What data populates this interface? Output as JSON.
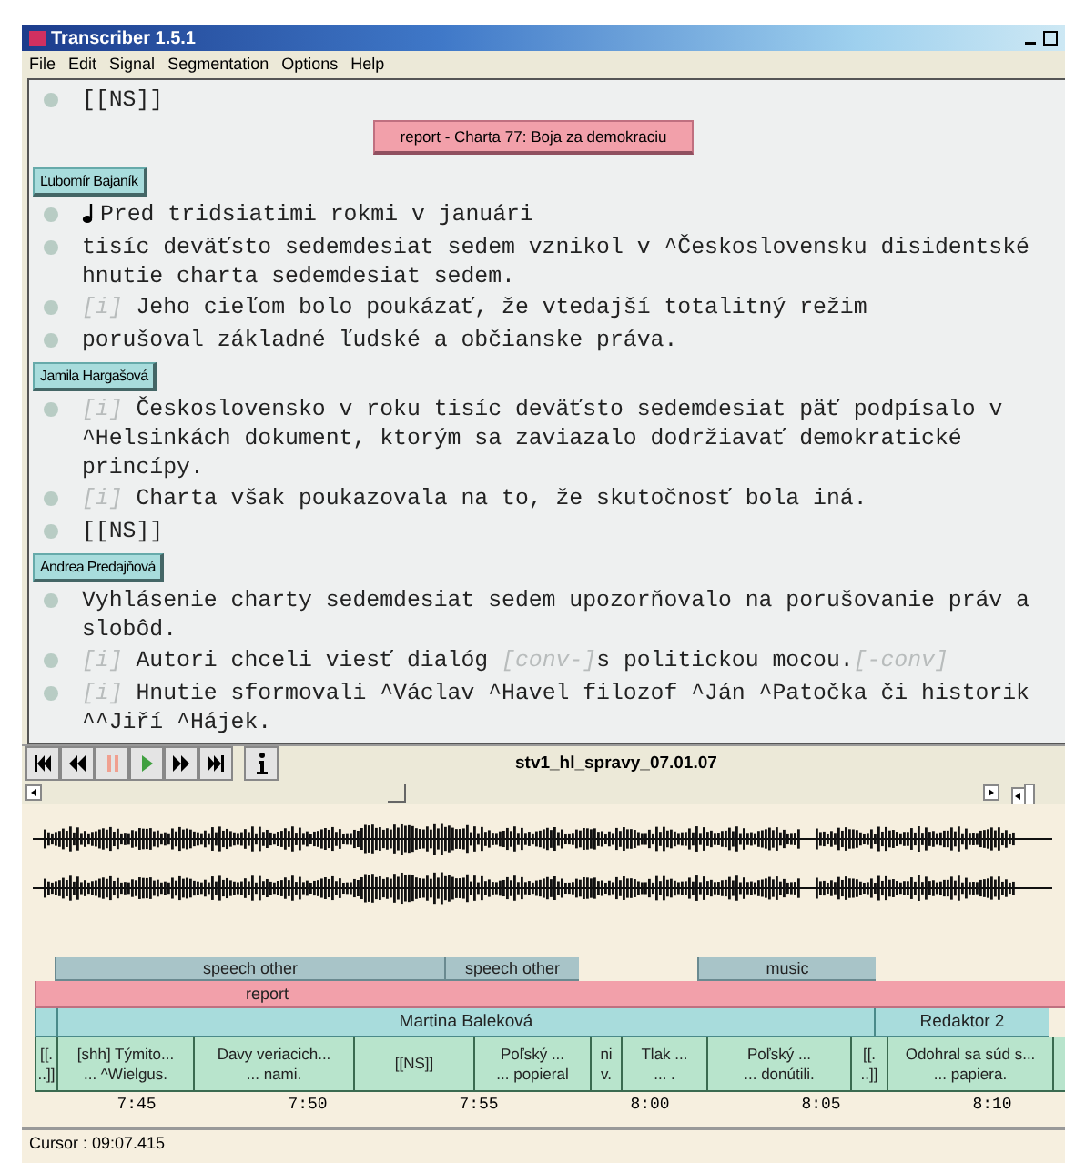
{
  "window": {
    "title": "Transcriber 1.5.1"
  },
  "menu": [
    "File",
    "Edit",
    "Signal",
    "Segmentation",
    "Options",
    "Help"
  ],
  "transcript": [
    {
      "kind": "line",
      "text": "[[NS]]"
    },
    {
      "kind": "section",
      "text": "report - Charta 77: Boja za demokraciu"
    },
    {
      "kind": "speaker",
      "text": "Ľubomír Bajaník"
    },
    {
      "kind": "line",
      "note": true,
      "text": "Pred tridsiatimi rokmi v januári"
    },
    {
      "kind": "line",
      "text": "tisíc deväťsto sedemdesiat sedem vznikol v ^Československu disidentské hnutie charta sedemdesiat sedem."
    },
    {
      "kind": "line",
      "text": "*[i]* Jeho cieľom bolo poukázať, že vtedajší totalitný režim"
    },
    {
      "kind": "line",
      "text": "porušoval základné ľudské a občianske práva."
    },
    {
      "kind": "speaker",
      "text": "Jamila Hargašová"
    },
    {
      "kind": "line",
      "text": "*[i]* Československo v roku tisíc deväťsto sedemdesiat päť podpísalo v ^Helsinkách dokument, ktorým sa zaviazalo dodržiavať demokratické princípy."
    },
    {
      "kind": "line",
      "text": "*[i]* Charta však poukazovala na to, že skutočnosť bola iná."
    },
    {
      "kind": "line",
      "text": "[[NS]]"
    },
    {
      "kind": "speaker",
      "text": "Andrea Predajňová"
    },
    {
      "kind": "line",
      "text": "Vyhlásenie charty sedemdesiat sedem upozorňovalo na porušovanie práv a slobôd."
    },
    {
      "kind": "line",
      "parts": [
        {
          "kind": "tag",
          "text": "[i]"
        },
        {
          "kind": "text",
          "text": " Autori chceli viesť dialóg "
        },
        {
          "kind": "tag",
          "text": "[conv-]"
        },
        {
          "kind": "text",
          "text": "s politickou mocou."
        },
        {
          "kind": "tag",
          "text": "[-conv]"
        }
      ]
    },
    {
      "kind": "line",
      "text": "*[i]* Hnutie sformovali ^Václav ^Havel filozof ^Ján ^Patočka či historik ^^Jiří ^Hájek."
    }
  ],
  "player": {
    "file": "stv1_hl_spravy_07.01.07"
  },
  "tracks": {
    "topics": [
      "speech other",
      "speech other",
      "music"
    ],
    "sections": [
      "report"
    ],
    "speakers": [
      "Martina Baleková",
      "Redaktor 2"
    ],
    "segments": [
      [
        "[[.",
        "..]]"
      ],
      [
        "[shh] Týmito...",
        "... ^Wielgus."
      ],
      [
        "Davy veriacich...",
        "... nami."
      ],
      [
        "[[NS]]"
      ],
      [
        "Poľský ...",
        "... popieral"
      ],
      [
        "ni",
        "v."
      ],
      [
        "Tlak ...",
        "... ."
      ],
      [
        "Poľský ...",
        "... donútili."
      ],
      [
        "[[.",
        "..]]"
      ],
      [
        "Odohral sa súd s...",
        "... papiera."
      ]
    ]
  },
  "axis": [
    "7:45",
    "7:50",
    "7:55",
    "8:00",
    "8:05",
    "8:10"
  ],
  "status": "Cursor : 09:07.415"
}
